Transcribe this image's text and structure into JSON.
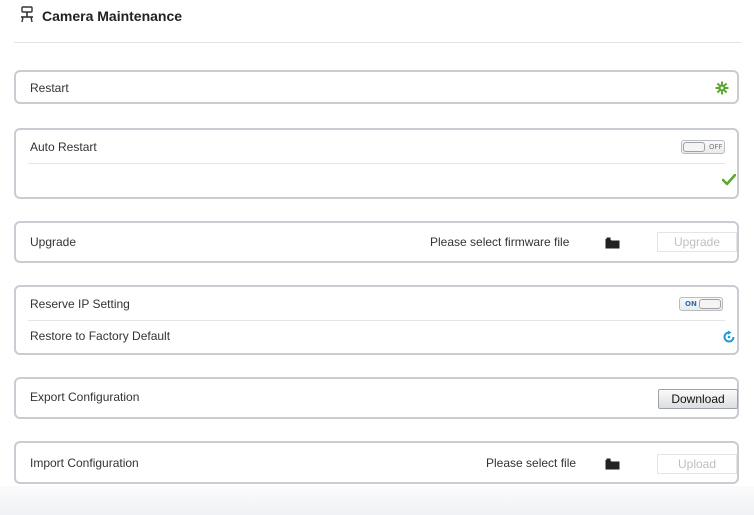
{
  "header": {
    "icon": "camera-icon",
    "title": "Camera Maintenance"
  },
  "restart": {
    "label": "Restart",
    "icon": "restart-gear-icon",
    "icon_color": "#5aa832"
  },
  "auto_restart": {
    "label": "Auto Restart",
    "toggle_text": "OFF",
    "toggle_state": "off",
    "save_icon": "checkmark-icon",
    "save_icon_color": "#5aa832"
  },
  "upgrade": {
    "label": "Upgrade",
    "file_prompt": "Please select firmware file",
    "folder_icon": "folder-icon",
    "button_label": "Upgrade"
  },
  "reserve_ip": {
    "label": "Reserve IP Setting",
    "toggle_text": "ON",
    "toggle_state": "on"
  },
  "factory_default": {
    "label": "Restore to Factory Default",
    "icon": "restore-icon",
    "icon_color": "#1e9ad6"
  },
  "export_config": {
    "label": "Export Configuration",
    "button_label": "Download"
  },
  "import_config": {
    "label": "Import Configuration",
    "file_prompt": "Please select file",
    "folder_icon": "folder-icon",
    "button_label": "Upload"
  },
  "colors": {
    "panel_border": "#c9ccd3",
    "accent_green": "#5aa832",
    "accent_blue": "#1e9ad6"
  }
}
